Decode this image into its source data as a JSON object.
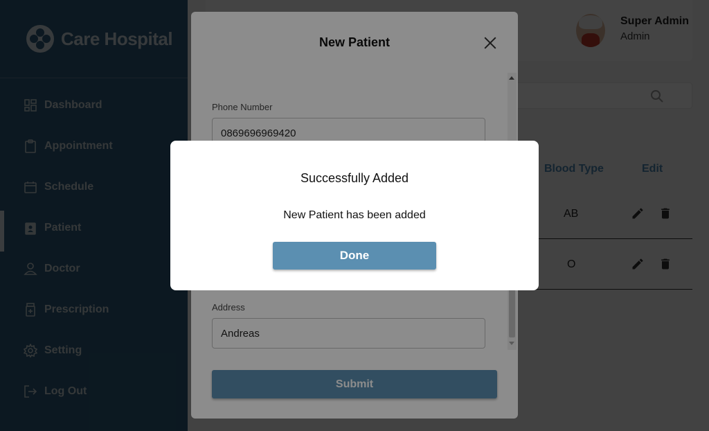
{
  "app": {
    "name": "Care Hospital",
    "logo_icon": "clover-logo-icon"
  },
  "colors": {
    "sidebar": "#2d5b78",
    "accent": "#5b8fb1",
    "header_text": "#4a86b0"
  },
  "sidebar": {
    "items": [
      {
        "label": "Dashboard",
        "icon": "dashboard-icon"
      },
      {
        "label": "Appointment",
        "icon": "clipboard-icon"
      },
      {
        "label": "Schedule",
        "icon": "calendar-icon"
      },
      {
        "label": "Patient",
        "icon": "patient-icon",
        "active": true
      },
      {
        "label": "Doctor",
        "icon": "person-icon"
      },
      {
        "label": "Prescription",
        "icon": "medicine-icon"
      },
      {
        "label": "Setting",
        "icon": "gear-icon"
      },
      {
        "label": "Log Out",
        "icon": "logout-icon"
      }
    ]
  },
  "header": {
    "user_name": "Super Admin",
    "user_role": "Admin"
  },
  "table": {
    "columns": [
      "Blood Type",
      "Edit"
    ],
    "rows": [
      {
        "blood_type": "AB"
      },
      {
        "blood_type": "O"
      }
    ]
  },
  "modal": {
    "title": "New Patient",
    "phone_label": "Phone Number",
    "phone_value": "0869696969420",
    "address_label": "Address",
    "address_value": "Andreas",
    "submit_label": "Submit"
  },
  "dialog": {
    "title": "Successfully Added",
    "message": "New Patient has been added",
    "done_label": "Done"
  }
}
